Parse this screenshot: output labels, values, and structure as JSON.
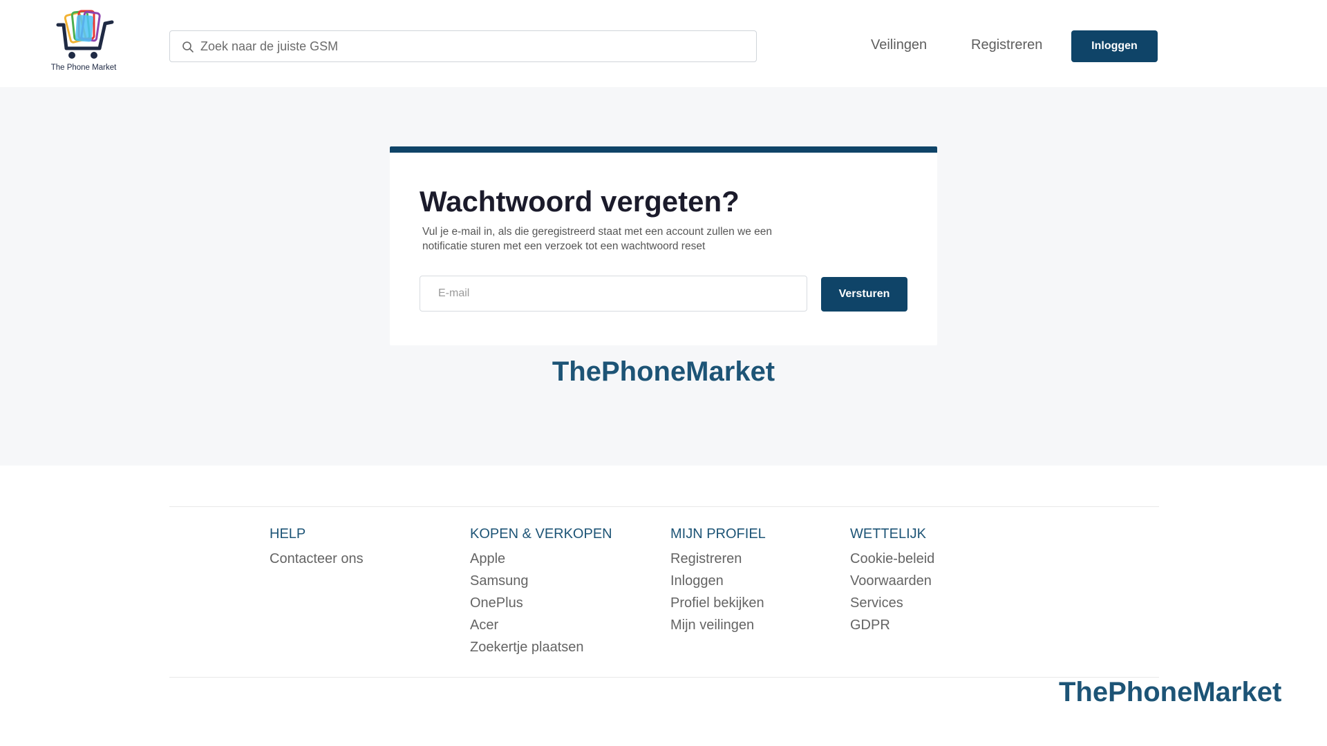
{
  "header": {
    "logo_text": "The Phone Market",
    "search_placeholder": "Zoek naar de juiste GSM",
    "nav": {
      "veilingen": "Veilingen",
      "registreren": "Registreren",
      "login_label": "Inloggen"
    }
  },
  "card": {
    "title": "Wachtwoord vergeten?",
    "description": "Vul je e-mail in, als die geregistreerd staat met een account zullen we een notificatie sturen met een verzoek tot een wachtwoord reset",
    "email_placeholder": "E-mail",
    "submit_label": "Versturen"
  },
  "brand_text": "ThePhoneMarket",
  "footer": {
    "columns": [
      {
        "heading": "HELP",
        "links": [
          "Contacteer ons"
        ]
      },
      {
        "heading": "KOPEN & VERKOPEN",
        "links": [
          "Apple",
          "Samsung",
          "OnePlus",
          "Acer",
          "Zoekertje plaatsen"
        ]
      },
      {
        "heading": "MIJN PROFIEL",
        "links": [
          "Registreren",
          "Inloggen",
          "Profiel bekijken",
          "Mijn veilingen"
        ]
      },
      {
        "heading": "WETTELIJK",
        "links": [
          "Cookie-beleid",
          "Voorwaarden",
          "Services",
          "GDPR"
        ]
      }
    ],
    "brand_text": "ThePhoneMarket"
  },
  "colors": {
    "primary": "#0f4468",
    "brand_text": "#1d5476",
    "page_bg": "#f6f7f9"
  }
}
